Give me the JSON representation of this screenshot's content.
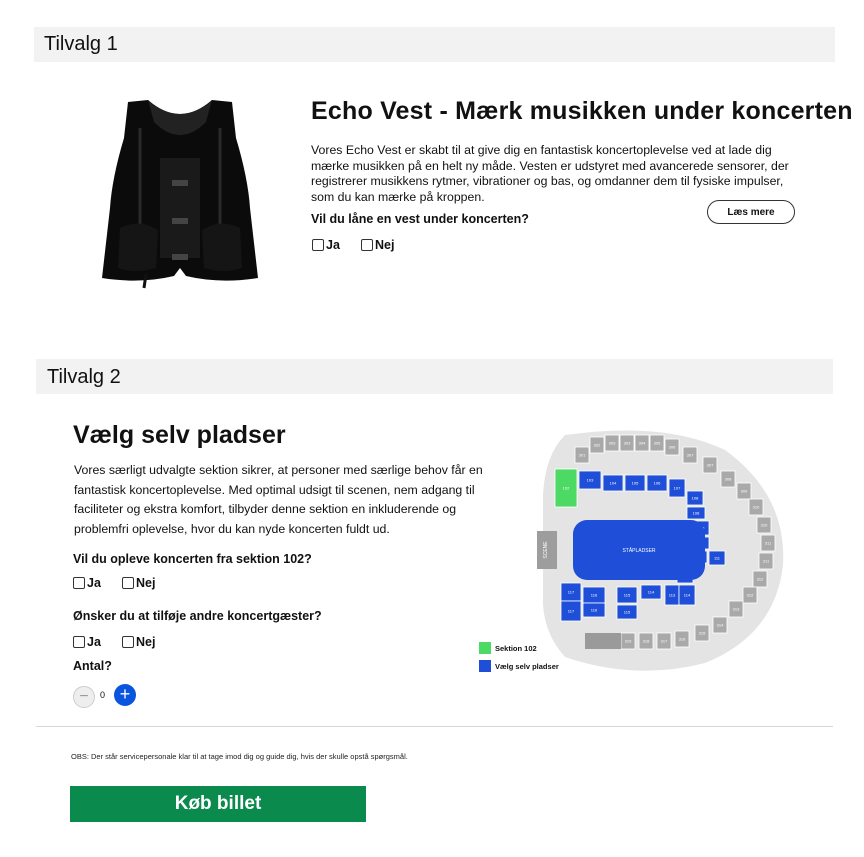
{
  "option1": {
    "band_label": "Tilvalg 1",
    "title": "Echo Vest - Mærk musikken under koncerten",
    "description": "Vores Echo Vest er skabt til at give dig en fantastisk koncertoplevelse ved at lade dig mærke musikken på en helt ny måde. Vesten er udstyret med avancerede sensorer, der registrerer musikkens rytmer, vibrationer og bas, og omdanner dem til fysiske impulser, som du kan mærke på kroppen.",
    "question": "Vil du låne en vest under koncerten?",
    "yes_label": "Ja",
    "no_label": "Nej",
    "read_more_label": "Læs mere"
  },
  "option2": {
    "band_label": "Tilvalg 2",
    "title": "Vælg selv pladser",
    "description": "Vores særligt udvalgte sektion sikrer, at personer med særlige behov får en fantastisk koncertoplevelse. Med optimal udsigt til scenen, nem adgang til faciliteter og ekstra komfort, tilbyder denne sektion en inkluderende og problemfri oplevelse, hvor du kan nyde koncerten fuldt ud.",
    "question_section": "Vil du opleve koncerten fra sektion 102?",
    "question_guests": "Ønsker du at tilføje andre koncertgæster?",
    "yes_label": "Ja",
    "no_label": "Nej",
    "amount_label": "Antal?",
    "amount_value": "0",
    "minus_symbol": "−",
    "plus_symbol": "+"
  },
  "seat_map": {
    "stage_label": "SCENE",
    "floor_label": "STÅPLADSER",
    "highlight_color": "#4cd964",
    "selectable_color": "#1f4fd8",
    "upper_color": "#a9a9a9",
    "upper_sections": [
      "301",
      "302",
      "303",
      "303",
      "304",
      "305",
      "306",
      "307",
      "307",
      "308",
      "309",
      "310",
      "310",
      "311",
      "311",
      "312",
      "312",
      "313",
      "314",
      "315",
      "316",
      "317",
      "318",
      "319"
    ],
    "lower_sections": [
      "102",
      "103",
      "104",
      "105",
      "106",
      "107",
      "108",
      "108",
      "109",
      "110",
      "111",
      "111",
      "112",
      "113",
      "114",
      "114",
      "115",
      "115",
      "116",
      "116",
      "117",
      "117"
    ],
    "legend": [
      {
        "label": "Sektion 102",
        "color": "#4cd964"
      },
      {
        "label": "Vælg selv pladser",
        "color": "#1f4fd8"
      }
    ]
  },
  "footer": {
    "note": "OBS: Der står servicepersonale klar til at tage imod dig og guide dig, hvis der skulle opstå spørgsmål.",
    "buy_label": "Køb billet",
    "buy_color": "#0a8a4c"
  }
}
